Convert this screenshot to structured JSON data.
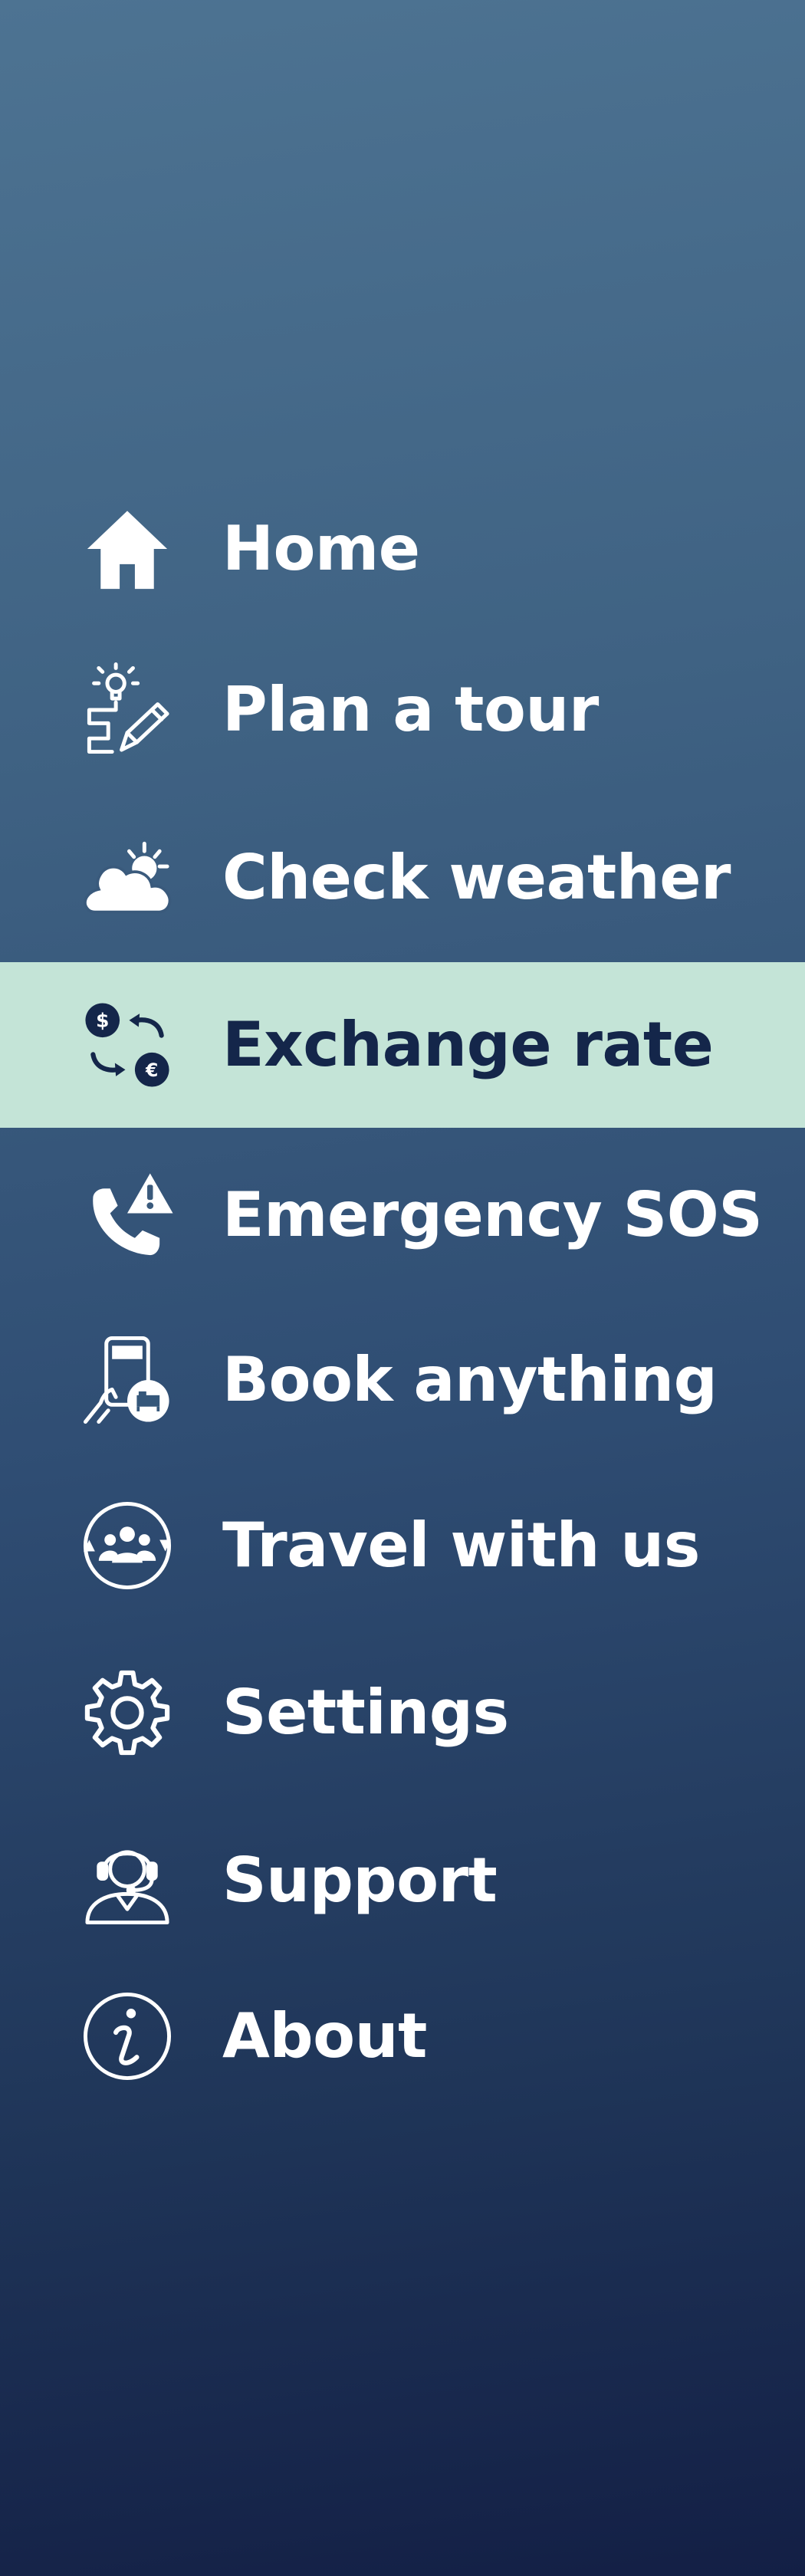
{
  "nav": {
    "items": [
      {
        "label": "Home",
        "icon": "home-icon",
        "active": false
      },
      {
        "label": "Plan a tour",
        "icon": "plan-tour-icon",
        "active": false
      },
      {
        "label": "Check weather",
        "icon": "weather-icon",
        "active": false
      },
      {
        "label": "Exchange rate",
        "icon": "exchange-rate-icon",
        "active": true
      },
      {
        "label": "Emergency SOS",
        "icon": "emergency-sos-icon",
        "active": false
      },
      {
        "label": "Book anything",
        "icon": "booking-icon",
        "active": false
      },
      {
        "label": "Travel with us",
        "icon": "travel-group-icon",
        "active": false
      },
      {
        "label": "Settings",
        "icon": "gear-icon",
        "active": false
      },
      {
        "label": "Support",
        "icon": "support-agent-icon",
        "active": false
      },
      {
        "label": "About",
        "icon": "info-icon",
        "active": false
      }
    ]
  },
  "colors": {
    "background_top": "#4d7392",
    "background_bottom": "#131f45",
    "active_background": "#c4e4d7",
    "active_text": "#14264a",
    "text": "#ffffff"
  }
}
